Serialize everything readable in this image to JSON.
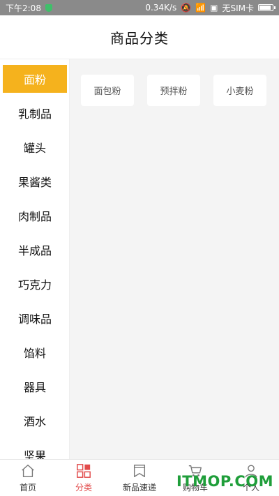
{
  "status_bar": {
    "time": "下午2:08",
    "speed": "0.34K/s",
    "sim": "无SIM卡"
  },
  "header": {
    "title": "商品分类"
  },
  "sidebar": {
    "items": [
      {
        "label": "面粉",
        "active": true
      },
      {
        "label": "乳制品"
      },
      {
        "label": "罐头"
      },
      {
        "label": "果酱类"
      },
      {
        "label": "肉制品"
      },
      {
        "label": "半成品"
      },
      {
        "label": "巧克力"
      },
      {
        "label": "调味品"
      },
      {
        "label": "馅料"
      },
      {
        "label": "器具"
      },
      {
        "label": "酒水"
      },
      {
        "label": "坚果"
      }
    ]
  },
  "content": {
    "subcategories": [
      "面包粉",
      "预拌粉",
      "小麦粉"
    ]
  },
  "tabbar": {
    "tabs": [
      {
        "label": "首页",
        "icon": "home-icon"
      },
      {
        "label": "分类",
        "icon": "grid-icon",
        "active": true
      },
      {
        "label": "新品速递",
        "icon": "bookmark-icon"
      },
      {
        "label": "购物车",
        "icon": "cart-icon"
      },
      {
        "label": "个人",
        "icon": "user-icon"
      }
    ]
  },
  "colors": {
    "accent": "#f5b21d",
    "tab_active": "#e24b4b"
  },
  "watermark": "ITMOP.COM"
}
